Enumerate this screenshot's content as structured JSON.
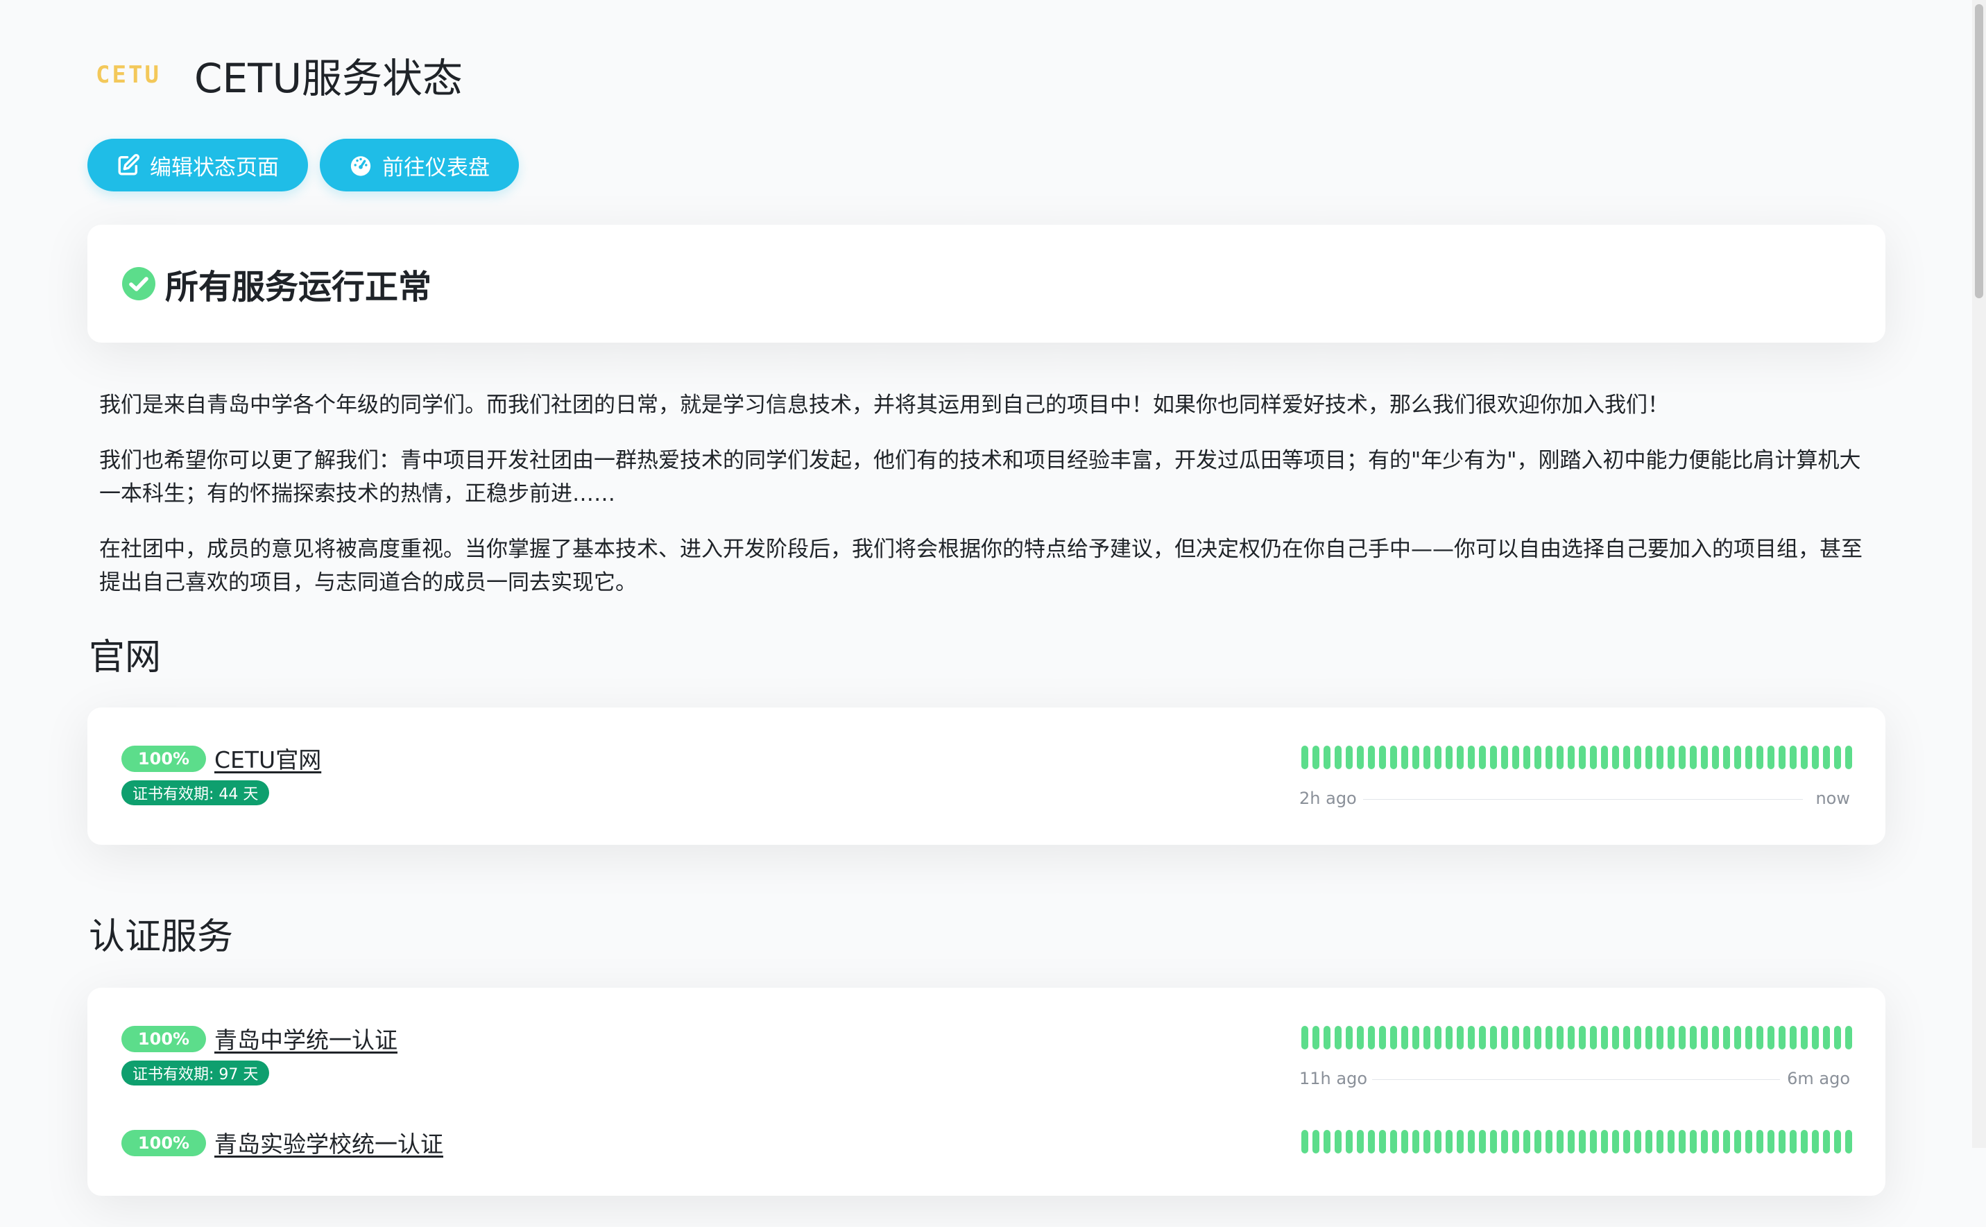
{
  "header": {
    "logo_text": "CETU",
    "title": "CETU服务状态"
  },
  "toolbar": {
    "edit_label": "编辑状态页面",
    "dashboard_label": "前往仪表盘",
    "icons": [
      "edit-icon",
      "gauge-icon"
    ]
  },
  "status": {
    "text": "所有服务运行正常",
    "icon": "check-circle-icon",
    "color": "#5cdd8b"
  },
  "description": [
    "我们是来自青岛中学各个年级的同学们。而我们社团的日常，就是学习信息技术，并将其运用到自己的项目中！如果你也同样爱好技术，那么我们很欢迎你加入我们！",
    "我们也希望你可以更了解我们：青中项目开发社团由一群热爱技术的同学们发起，他们有的技术和项目经验丰富，开发过瓜田等项目；有的\"年少有为\"，刚踏入初中能力便能比肩计算机大一本科生；有的怀揣探索技术的热情，正稳步前进……",
    "在社团中，成员的意见将被高度重视。当你掌握了基本技术、进入开发阶段后，我们将会根据你的特点给予建议，但决定权仍在你自己手中——你可以自由选择自己要加入的项目组，甚至提出自己喜欢的项目，与志同道合的成员一同去实现它。"
  ],
  "groups": [
    {
      "title": "官网",
      "monitors": [
        {
          "uptime": "100%",
          "name": "CETU官网",
          "cert": "证书有效期: 44 天",
          "time_left": "2h ago",
          "time_right": "now"
        }
      ]
    },
    {
      "title": "认证服务",
      "monitors": [
        {
          "uptime": "100%",
          "name": "青岛中学统一认证",
          "cert": "证书有效期: 97 天",
          "time_left": "11h ago",
          "time_right": "6m ago"
        },
        {
          "uptime": "100%",
          "name": "青岛实验学校统一认证",
          "cert": "",
          "time_left": "",
          "time_right": ""
        }
      ]
    }
  ],
  "colors": {
    "accent": "#1fbde7",
    "up": "#5cdd8b",
    "cert": "#0e9f6e"
  }
}
